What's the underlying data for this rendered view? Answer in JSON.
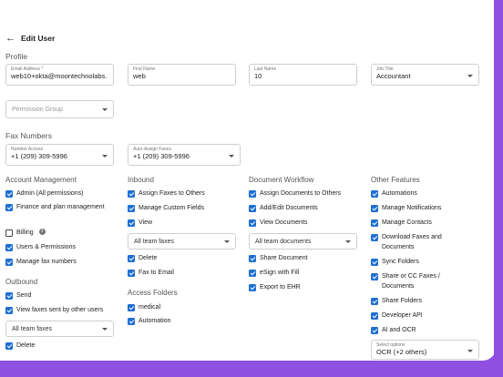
{
  "header": {
    "title": "Edit User"
  },
  "profile": {
    "section": "Profile",
    "email_label": "Email Address *",
    "email_value": "web10+okta@moontechnolabs.",
    "first_label": "First Name",
    "first_value": "web",
    "last_label": "Last Name",
    "last_value": "10",
    "job_label": "Job Title",
    "job_value": "Accountant",
    "permission_placeholder": "Permission Group"
  },
  "fax_numbers": {
    "section": "Fax Numbers",
    "access_label": "Number Access",
    "access_value": "+1 (209) 309-5996",
    "auto_label": "Auto-Assign Faxes",
    "auto_value": "+1 (209) 309-5996"
  },
  "account_management": {
    "title": "Account Management",
    "items": [
      {
        "label": "Admin (All permissions)",
        "checked": true
      },
      {
        "label": "Finance and plan management",
        "checked": true
      },
      {
        "label": "Billing",
        "checked": false
      },
      {
        "label": "Users & Permissions",
        "checked": true
      },
      {
        "label": "Manage fax numbers",
        "checked": true
      }
    ]
  },
  "outbound": {
    "title": "Outbound",
    "items": [
      {
        "label": "Send",
        "checked": true
      },
      {
        "label": "View faxes sent by other users",
        "checked": true
      }
    ],
    "select_value": "All team faxes",
    "delete_label": "Delete"
  },
  "inbound": {
    "title": "Inbound",
    "items": [
      {
        "label": "Assign Faxes to Others",
        "checked": true
      },
      {
        "label": "Manage Custom Fields",
        "checked": true
      },
      {
        "label": "View",
        "checked": true
      }
    ],
    "select_value": "All team faxes",
    "items2": [
      {
        "label": "Delete",
        "checked": true
      },
      {
        "label": "Fax to Email",
        "checked": true
      }
    ]
  },
  "access_folders": {
    "title": "Access Folders",
    "items": [
      {
        "label": "medical",
        "checked": true
      },
      {
        "label": "Automation",
        "checked": true
      }
    ]
  },
  "document_workflow": {
    "title": "Document Workflow",
    "items": [
      {
        "label": "Assign Documents to Others",
        "checked": true
      },
      {
        "label": "Add/Edit Documents",
        "checked": true
      },
      {
        "label": "View Documents",
        "checked": true
      }
    ],
    "select_value": "All team documents",
    "items2": [
      {
        "label": "Share Document",
        "checked": true
      },
      {
        "label": "eSign with Fill",
        "checked": true
      },
      {
        "label": "Export to EHR",
        "checked": true
      }
    ]
  },
  "other_features": {
    "title": "Other Features",
    "items": [
      {
        "label": "Automations",
        "checked": true
      },
      {
        "label": "Manage Notifications",
        "checked": true
      },
      {
        "label": "Manage Contacts",
        "checked": true
      },
      {
        "label": "Download Faxes and Documents",
        "checked": true
      },
      {
        "label": "Sync Folders",
        "checked": true
      },
      {
        "label": "Share or CC Faxes / Documents",
        "checked": true
      },
      {
        "label": "Share Folders",
        "checked": true
      },
      {
        "label": "Developer API",
        "checked": true
      },
      {
        "label": "AI and OCR",
        "checked": true
      }
    ],
    "select_label": "Select options",
    "select_value": "OCR (+2 others)"
  },
  "colors": {
    "accent": "#1f6fd1",
    "frame": "#8f4fe0"
  }
}
